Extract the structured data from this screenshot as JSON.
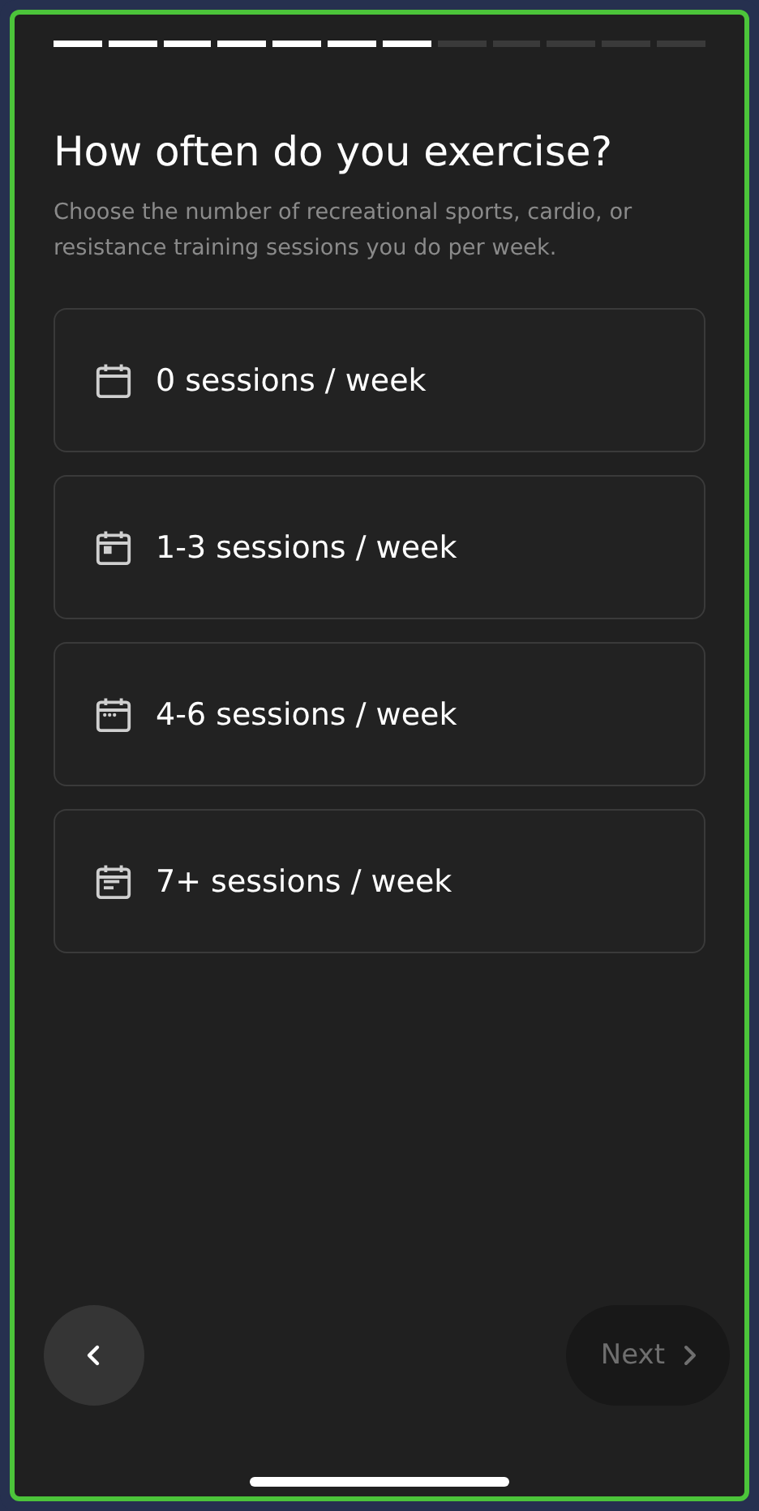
{
  "progress": {
    "steps": [
      {
        "done": true
      },
      {
        "done": true
      },
      {
        "done": true
      },
      {
        "done": true
      },
      {
        "done": true
      },
      {
        "done": true
      },
      {
        "done": true
      },
      {
        "done": false
      },
      {
        "done": false
      },
      {
        "done": false
      },
      {
        "done": false
      },
      {
        "done": false
      }
    ]
  },
  "title": "How often do you exercise?",
  "subtitle": "Choose the number of recreational sports, cardio, or resistance training sessions you do per week.",
  "options": [
    {
      "label": "0 sessions / week",
      "kind": "empty",
      "selected": false
    },
    {
      "label": "1-3 sessions / week",
      "kind": "dot",
      "selected": false
    },
    {
      "label": "4-6 sessions / week",
      "kind": "dots",
      "selected": false
    },
    {
      "label": "7+ sessions / week",
      "kind": "lines",
      "selected": false
    }
  ],
  "next_button": {
    "label": "Next",
    "disabled": true
  }
}
